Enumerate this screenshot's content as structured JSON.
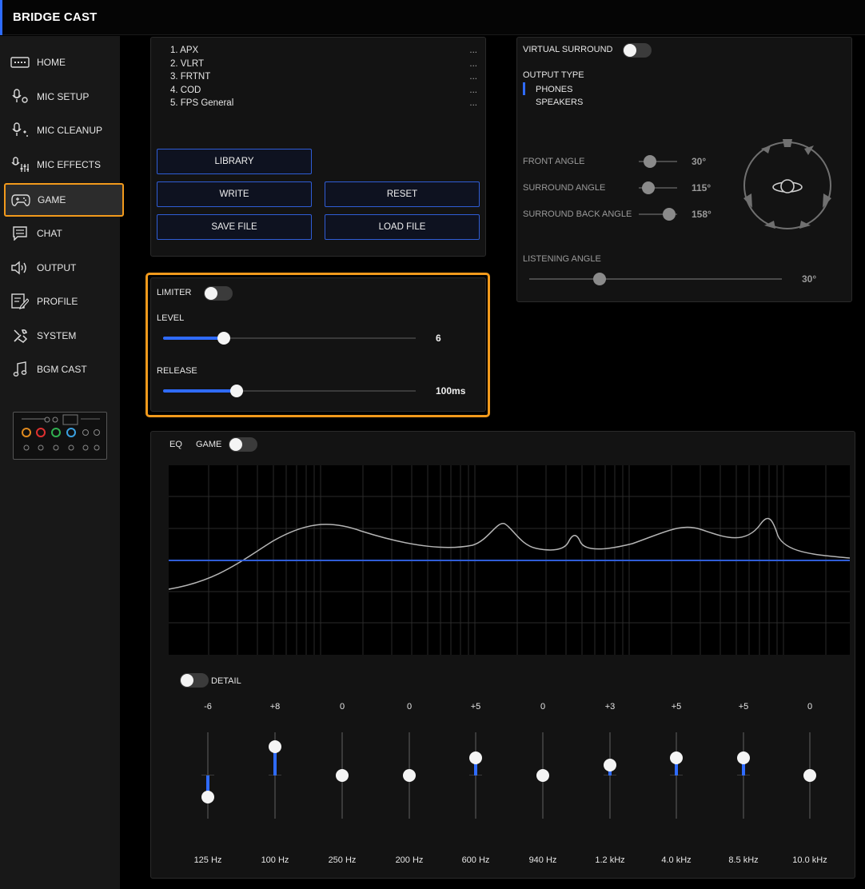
{
  "app": {
    "title": "BRIDGE CAST"
  },
  "sidebar": {
    "items": [
      {
        "label": "HOME",
        "icon": "keyboard-icon"
      },
      {
        "label": "MIC SETUP",
        "icon": "mic-gear-icon"
      },
      {
        "label": "MIC CLEANUP",
        "icon": "mic-sparkle-icon"
      },
      {
        "label": "MIC EFFECTS",
        "icon": "mic-sliders-icon"
      },
      {
        "label": "GAME",
        "icon": "gamepad-icon",
        "active": true
      },
      {
        "label": "CHAT",
        "icon": "chat-icon"
      },
      {
        "label": "OUTPUT",
        "icon": "speaker-icon"
      },
      {
        "label": "PROFILE",
        "icon": "profile-edit-icon"
      },
      {
        "label": "SYSTEM",
        "icon": "wrench-icon"
      },
      {
        "label": "BGM CAST",
        "icon": "music-note-icon"
      }
    ]
  },
  "presets": {
    "items": [
      {
        "name": "1. APX",
        "more": "..."
      },
      {
        "name": "2. VLRT",
        "more": "..."
      },
      {
        "name": "3. FRTNT",
        "more": "..."
      },
      {
        "name": "4. COD",
        "more": "..."
      },
      {
        "name": "5. FPS General",
        "more": "..."
      }
    ],
    "buttons": {
      "library": "LIBRARY",
      "write": "WRITE",
      "reset": "RESET",
      "save_file": "SAVE FILE",
      "load_file": "LOAD FILE"
    }
  },
  "limiter": {
    "label": "LIMITER",
    "enabled": false,
    "level": {
      "label": "LEVEL",
      "value": "6",
      "fraction": 0.24
    },
    "release": {
      "label": "RELEASE",
      "value": "100ms",
      "fraction": 0.29
    }
  },
  "surround": {
    "label": "VIRTUAL SURROUND",
    "enabled": false,
    "output_type_label": "OUTPUT TYPE",
    "output_options": [
      "PHONES",
      "SPEAKERS"
    ],
    "selected_output": "PHONES",
    "front_angle": {
      "label": "FRONT ANGLE",
      "value": "30°",
      "fraction": 0.3
    },
    "surround_angle": {
      "label": "SURROUND ANGLE",
      "value": "115°",
      "fraction": 0.25
    },
    "surround_back_angle": {
      "label": "SURROUND BACK ANGLE",
      "value": "158°",
      "fraction": 0.8
    },
    "listening_angle": {
      "label": "LISTENING ANGLE",
      "value": "30°",
      "fraction": 0.28
    }
  },
  "eq": {
    "label": "EQ",
    "source_label": "GAME",
    "enabled": false,
    "detail_label": "DETAIL",
    "detail_enabled": false,
    "gain_range_db": [
      -12,
      12
    ],
    "bands": [
      {
        "value": "-6",
        "gain": -6,
        "freq": "125 Hz"
      },
      {
        "value": "+8",
        "gain": 8,
        "freq": "100 Hz"
      },
      {
        "value": "0",
        "gain": 0,
        "freq": "250 Hz"
      },
      {
        "value": "0",
        "gain": 0,
        "freq": "200 Hz"
      },
      {
        "value": "+5",
        "gain": 5,
        "freq": "600 Hz"
      },
      {
        "value": "0",
        "gain": 0,
        "freq": "940 Hz"
      },
      {
        "value": "+3",
        "gain": 3,
        "freq": "1.2 kHz"
      },
      {
        "value": "+5",
        "gain": 5,
        "freq": "4.0 kHz"
      },
      {
        "value": "+5",
        "gain": 5,
        "freq": "8.5 kHz"
      },
      {
        "value": "0",
        "gain": 0,
        "freq": "10.0 kHz"
      }
    ]
  },
  "colors": {
    "accent": "#2f6bff",
    "highlight": "#f29a1c",
    "background": "#000000",
    "panel": "#131313"
  }
}
